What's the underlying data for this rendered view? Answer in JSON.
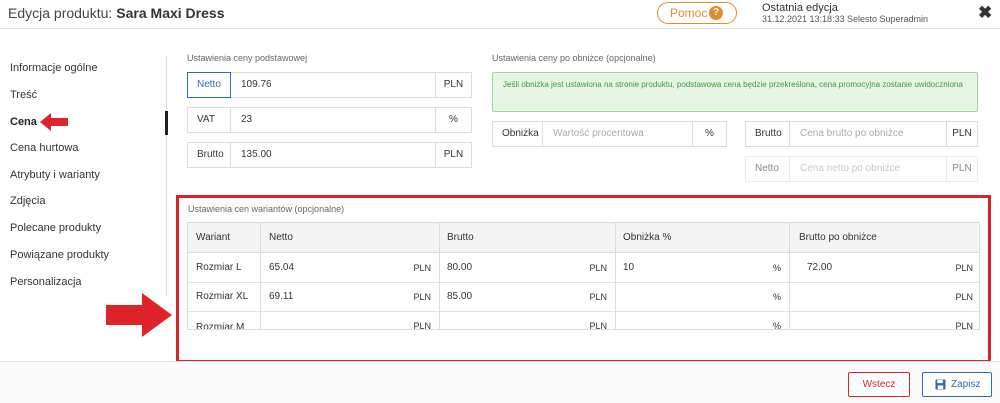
{
  "header": {
    "title_label": "Edycja produktu:",
    "product_name": "Sara Maxi Dress",
    "help_label": "Pomoc",
    "help_icon": "question-icon",
    "last_edit_title": "Ostatnia edycja",
    "last_edit_date": "31.12.2021  13:18:33",
    "last_edit_user": "Selesto Superadmin",
    "close_icon": "close-icon"
  },
  "sidebar": {
    "items": [
      {
        "label": "Informacje ogólne"
      },
      {
        "label": "Treść"
      },
      {
        "label": "Cena"
      },
      {
        "label": "Cena hurtowa"
      },
      {
        "label": "Atrybuty i warianty"
      },
      {
        "label": "Zdjęcia"
      },
      {
        "label": "Polecane produkty"
      },
      {
        "label": "Powiązane produkty"
      },
      {
        "label": "Personalizacja"
      }
    ],
    "active_index": 2
  },
  "base_price": {
    "section_title": "Ustawienia ceny podstawowej",
    "netto": {
      "label": "Netto",
      "value": "109.76",
      "unit": "PLN"
    },
    "vat": {
      "label": "VAT",
      "value": "23",
      "unit": "%"
    },
    "brutto": {
      "label": "Brutto",
      "value": "135.00",
      "unit": "PLN"
    }
  },
  "discount_price": {
    "section_title": "Ustawienia ceny po obniżce (opcjonalne)",
    "alert": "Jeśli obniżka jest ustawiona na stronie produktu, podstawowa cena będzie przekreślona, cena promocyjna zostanie uwidoczniona",
    "discount": {
      "label": "Obniżka",
      "placeholder": "Wartość procentowa",
      "unit": "%"
    },
    "brutto_after": {
      "label": "Brutto",
      "placeholder": "Cena brutto po obniżce",
      "unit": "PLN"
    },
    "netto_after": {
      "label": "Netto",
      "placeholder": "Cena netto po obniżce",
      "unit": "PLN"
    }
  },
  "variants": {
    "section_title": "Ustawienia cen wariantów (opcjonalne)",
    "columns": [
      "Wariant",
      "Netto",
      "Brutto",
      "Obniżka %",
      "Brutto po obniżce"
    ],
    "rows": [
      {
        "name": "Rozmiar L",
        "netto": "65.04",
        "netto_unit": "PLN",
        "brutto": "80.00",
        "brutto_unit": "PLN",
        "discount": "10",
        "discount_unit": "%",
        "brutto_after": "72.00",
        "brutto_after_unit": "PLN"
      },
      {
        "name": "Rozmiar XL",
        "netto": "69.11",
        "netto_unit": "PLN",
        "brutto": "85.00",
        "brutto_unit": "PLN",
        "discount": "",
        "discount_unit": "%",
        "brutto_after": "",
        "brutto_after_unit": "PLN"
      },
      {
        "name": "Rozmiar M",
        "netto": "",
        "netto_unit": "PLN",
        "brutto": "",
        "brutto_unit": "PLN",
        "discount": "",
        "discount_unit": "%",
        "brutto_after": "",
        "brutto_after_unit": "PLN"
      }
    ]
  },
  "footer": {
    "back_label": "Wstecz",
    "save_label": "Zapisz",
    "save_icon": "floppy-disk-icon"
  },
  "colors": {
    "accent_red": "#d9232a",
    "accent_blue": "#2e6cb5",
    "help_orange": "#e38c2f",
    "alert_green": "#3d9c3a"
  }
}
